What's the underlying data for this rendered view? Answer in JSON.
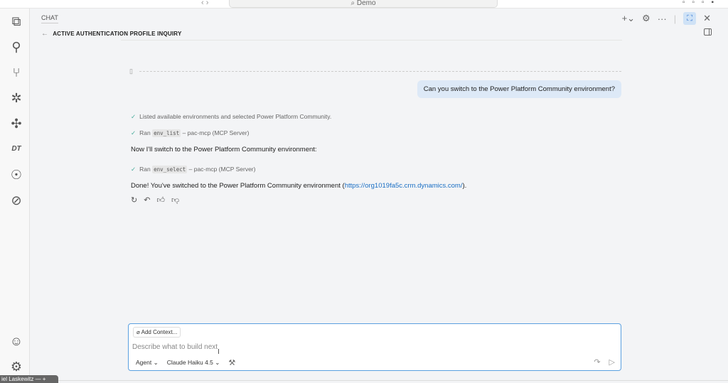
{
  "titlebar": {
    "search": "Demo"
  },
  "chat": {
    "header": "CHAT",
    "title": "ACTIVE AUTHENTICATION PROFILE INQUIRY"
  },
  "messages": {
    "user": "Can you switch to the Power Platform Community environment?",
    "step1": "Listed available environments and selected Power Platform Community.",
    "step2_prefix": "Ran",
    "step2_code": "env_list",
    "step2_suffix": "– pac-mcp (MCP Server)",
    "text1": "Now I'll switch to the Power Platform Community environment:",
    "step3_prefix": "Ran",
    "step3_code": "env_select",
    "step3_suffix": "– pac-mcp (MCP Server)",
    "done_prefix": "Done! You've switched to the Power Platform Community environment (",
    "done_link": "https://org1019fa5c.crm.dynamics.com/",
    "done_suffix": ")."
  },
  "input": {
    "add_context": "Add Context...",
    "placeholder": "Describe what to build next",
    "mode": "Agent",
    "model": "Claude Haiku 4.5"
  },
  "user_tooltip": "iel Laskewitz"
}
